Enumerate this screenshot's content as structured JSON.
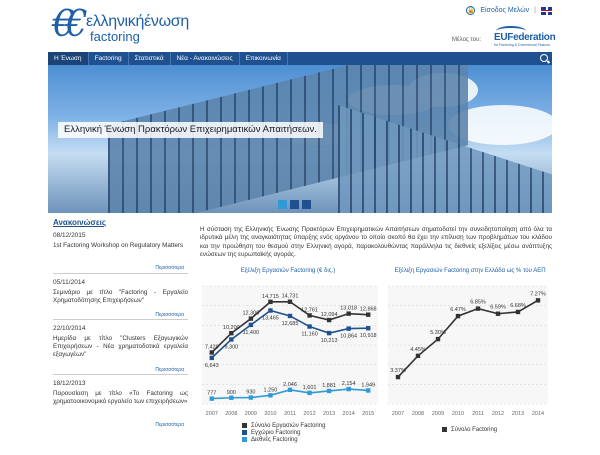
{
  "header": {
    "logo_mark": "€€",
    "logo_top": "ελληνικήένωση",
    "logo_bottom": "factoring",
    "member_login": "Είσοδος Μελών",
    "separator": "|",
    "member_of": "Μέλος του:",
    "euf_name": "EUFederation",
    "euf_sub": "for Factoring & Commercial Finance"
  },
  "nav": {
    "items": [
      {
        "label": "Η Ένωση"
      },
      {
        "label": "Factoring"
      },
      {
        "label": "Στατιστικά"
      },
      {
        "label": "Νέα - Ανακοινώσεις"
      },
      {
        "label": "Επικοινωνία"
      }
    ]
  },
  "banner": {
    "caption": "Ελληνική Ένωση Πρακτόρων Επιχειρηματικών Απαιτήσεων."
  },
  "news": {
    "heading": "Ανακοινώσεις",
    "more_label": "Περισσότερα",
    "items": [
      {
        "date": "08/12/2015",
        "title": "1st Factoring Workshop on Regulatory Matters"
      },
      {
        "date": "05/11/2014",
        "title": "Σεμινάριο με τίτλο \"Factoring - Εργαλείο Χρηματοδότησης Επιχειρήσεων\""
      },
      {
        "date": "22/10/2014",
        "title": "Ημερίδα με τίτλο \"Clusters Εξαγωγικών Επιχειρήσεων - Νέα χρηματοδοτικά εργαλεία εξαγωγέων\""
      },
      {
        "date": "18/12/2013",
        "title": "Παρουσίαση με τίτλο «Το Factoring ως χρηματοοικονομικό εργαλείο των επιχειρήσεων»"
      }
    ]
  },
  "intro": {
    "text": "Η σύσταση της Ελληνικής Ένωσης Πρακτόρων Επιχειρηματικών Απαιτήσεων σηματοδοτεί την συνειδητοποίηση από όλα τα ιδρυτικά μέλη της αναγκαιότητας ύπαρξης ενός οργάνου το οποίο σκοπό θα έχει την επίλυση των προβλημάτων του κλάδου και την προώθηση του θεσμού στην Ελληνική αγορά, παρακολουθώντας παράλληλα τις διεθνείς εξελίξεις μέσω ανάπτυξης ενώσεων της ευρωπαϊκής αγοράς."
  },
  "colors": {
    "nav": "#1f5190",
    "total": "#333333",
    "domestic": "#1f5190",
    "international": "#2f9ad6"
  },
  "chart_data": [
    {
      "type": "line",
      "title": "Εξέλιξη Εργασιών Factoring (€ δις.)",
      "categories": [
        "2007",
        "2008",
        "2009",
        "2010",
        "2011",
        "2012",
        "2013",
        "2014",
        "2015"
      ],
      "series": [
        {
          "name": "Σύνολο Εργασιών Factoring",
          "values": [
            7420,
            10200,
            12300,
            14715,
            14731,
            12761,
            12094,
            13018,
            12868
          ]
        },
        {
          "name": "Εγχώριο Factoring",
          "values": [
            6643,
            9300,
            11400,
            13465,
            12685,
            11160,
            10213,
            10864,
            10918
          ]
        },
        {
          "name": "Διεθνές Factoring",
          "values": [
            777,
            900,
            930,
            1250,
            2046,
            1601,
            1881,
            2154,
            1949
          ]
        }
      ],
      "ylim": [
        0,
        17000
      ],
      "grid": true,
      "legend": "bottom"
    },
    {
      "type": "line",
      "title": "Εξέλιξη Εργασιών Factoring στην Ελλάδα ως % του ΑΕΠ",
      "categories": [
        "2007",
        "2008",
        "2009",
        "2010",
        "2011",
        "2012",
        "2013",
        "2014"
      ],
      "series": [
        {
          "name": "Σύνολο Factoring",
          "values": [
            3.37,
            4.45,
            5.3,
            6.47,
            6.85,
            6.59,
            6.68,
            7.27
          ]
        }
      ],
      "labels": [
        "3.37%",
        "4.45%",
        "5.30%",
        "6.47%",
        "6.85%",
        "6.59%",
        "6.68%",
        "7.27%"
      ],
      "ylim": [
        2,
        8
      ],
      "grid": true,
      "legend": "bottom"
    }
  ]
}
